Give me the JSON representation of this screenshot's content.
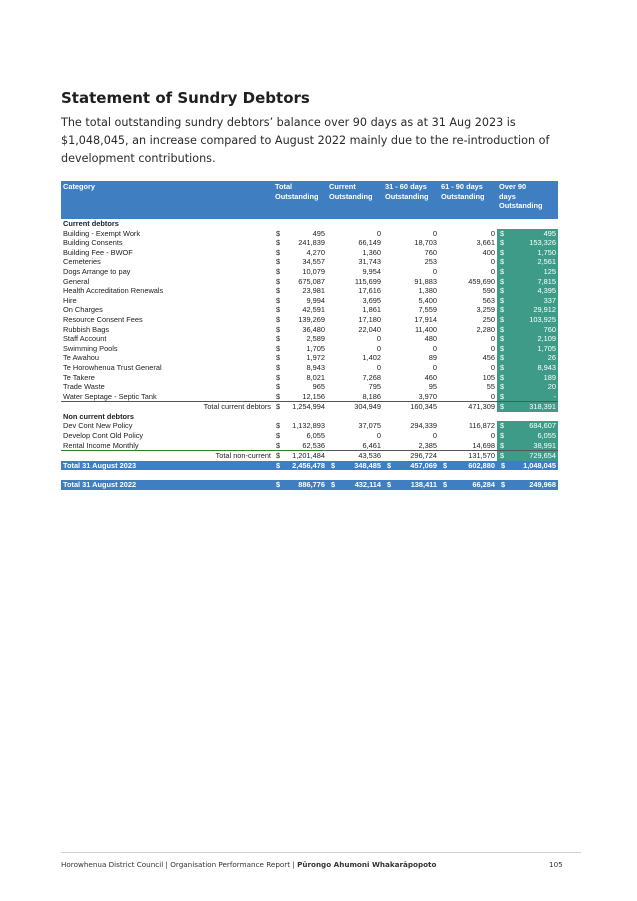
{
  "heading": "Statement of Sundry Debtors",
  "intro": "The total outstanding sundry debtors’ balance over 90 days as at 31 Aug 2023 is $1,048,045, an increase compared to August 2022 mainly due to the re-introduction of development contributions.",
  "table": {
    "headers": {
      "category": "Category",
      "total": [
        "Total",
        "Outstanding"
      ],
      "current": [
        "Current",
        "Outstanding"
      ],
      "d31_60": [
        "31 - 60 days",
        "Outstanding"
      ],
      "d61_90": [
        "61 - 90 days",
        "Outstanding"
      ],
      "over90": [
        "Over 90",
        "days",
        "Outstanding"
      ]
    },
    "current_section": "Current debtors",
    "current_rows": [
      {
        "category": "Building - Exempt Work",
        "total": "495",
        "current": "0",
        "d31_60": "0",
        "d61_90": "0",
        "over90": "495"
      },
      {
        "category": "Building Consents",
        "total": "241,839",
        "current": "66,149",
        "d31_60": "18,703",
        "d61_90": "3,661",
        "over90": "153,326"
      },
      {
        "category": "Building Fee - BWOF",
        "total": "4,270",
        "current": "1,360",
        "d31_60": "760",
        "d61_90": "400",
        "over90": "1,750"
      },
      {
        "category": "Cemeteries",
        "total": "34,557",
        "current": "31,743",
        "d31_60": "253",
        "d61_90": "0",
        "over90": "2,561"
      },
      {
        "category": "Dogs Arrange to pay",
        "total": "10,079",
        "current": "9,954",
        "d31_60": "0",
        "d61_90": "0",
        "over90": "125"
      },
      {
        "category": "General",
        "total": "675,087",
        "current": "115,699",
        "d31_60": "91,883",
        "d61_90": "459,690",
        "over90": "7,815"
      },
      {
        "category": "Health Accreditation Renewals",
        "total": "23,981",
        "current": "17,616",
        "d31_60": "1,380",
        "d61_90": "590",
        "over90": "4,395"
      },
      {
        "category": "Hire",
        "total": "9,994",
        "current": "3,695",
        "d31_60": "5,400",
        "d61_90": "563",
        "over90": "337"
      },
      {
        "category": "On Charges",
        "total": "42,591",
        "current": "1,861",
        "d31_60": "7,559",
        "d61_90": "3,259",
        "over90": "29,912"
      },
      {
        "category": "Resource Consent Fees",
        "total": "139,269",
        "current": "17,180",
        "d31_60": "17,914",
        "d61_90": "250",
        "over90": "103,925"
      },
      {
        "category": "Rubbish Bags",
        "total": "36,480",
        "current": "22,040",
        "d31_60": "11,400",
        "d61_90": "2,280",
        "over90": "760"
      },
      {
        "category": "Staff Account",
        "total": "2,589",
        "current": "0",
        "d31_60": "480",
        "d61_90": "0",
        "over90": "2,109"
      },
      {
        "category": "Swimming Pools",
        "total": "1,705",
        "current": "0",
        "d31_60": "0",
        "d61_90": "0",
        "over90": "1,705"
      },
      {
        "category": "Te Awahou",
        "total": "1,972",
        "current": "1,402",
        "d31_60": "89",
        "d61_90": "456",
        "over90": "26"
      },
      {
        "category": "Te Horowhenua Trust General",
        "total": "8,943",
        "current": "0",
        "d31_60": "0",
        "d61_90": "0",
        "over90": "8,943"
      },
      {
        "category": "Te Takere",
        "total": "8,021",
        "current": "7,268",
        "d31_60": "460",
        "d61_90": "105",
        "over90": "189"
      },
      {
        "category": "Trade Waste",
        "total": "965",
        "current": "795",
        "d31_60": "95",
        "d61_90": "55",
        "over90": "20"
      },
      {
        "category": "Water Septage - Septic Tank",
        "total": "12,156",
        "current": "8,186",
        "d31_60": "3,970",
        "d61_90": "0",
        "over90": "-"
      }
    ],
    "current_total": {
      "label": "Total current debtors",
      "total": "1,254,994",
      "current": "304,949",
      "d31_60": "160,345",
      "d61_90": "471,309",
      "over90": "318,391"
    },
    "noncurrent_section": "Non current debtors",
    "noncurrent_rows": [
      {
        "category": "Dev Cont New Policy",
        "total": "1,132,893",
        "current": "37,075",
        "d31_60": "294,339",
        "d61_90": "116,872",
        "over90": "684,607"
      },
      {
        "category": "Develop Cont Old Policy",
        "total": "6,055",
        "current": "0",
        "d31_60": "0",
        "d61_90": "0",
        "over90": "6,055"
      },
      {
        "category": "Rental Income Monthly",
        "total": "62,536",
        "current": "6,461",
        "d31_60": "2,385",
        "d61_90": "14,698",
        "over90": "38,991"
      }
    ],
    "noncurrent_total": {
      "label": "Total non-current",
      "total": "1,201,484",
      "current": "43,536",
      "d31_60": "296,724",
      "d61_90": "131,570",
      "over90": "729,654"
    },
    "total_2023": {
      "label": "Total 31 August 2023",
      "total": "2,456,478",
      "current": "348,485",
      "d31_60": "457,069",
      "d61_90": "602,880",
      "over90": "1,048,045"
    },
    "total_2022": {
      "label": "Total 31 August 2022",
      "total": "886,776",
      "current": "432,114",
      "d31_60": "138,411",
      "d61_90": "66,284",
      "over90": "249,968"
    },
    "currency": "$"
  },
  "footer": {
    "org": "Horowhenua District Council | Organisation Performance Report | ",
    "maori": "Pūrongo Ahumoni Whakarāpopoto",
    "page": "105"
  },
  "colors": {
    "header_blue": "#3f7ec0",
    "over90_green": "#3e9b87"
  }
}
